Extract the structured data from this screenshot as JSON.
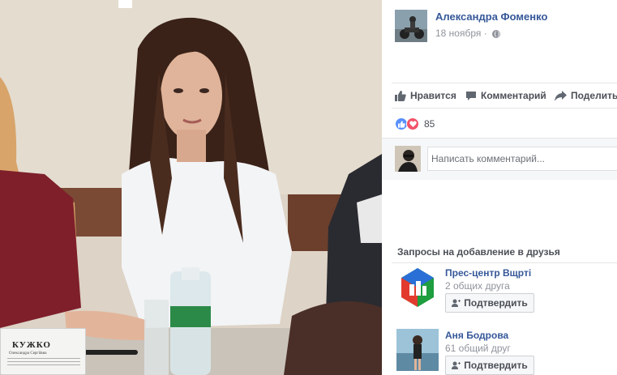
{
  "photo": {
    "placard_name": "КУЖКО",
    "placard_subtitle": "Олександра Сергіївна"
  },
  "post": {
    "author": "Александра Фоменко",
    "date": "18 ноября ·",
    "privacy_icon": "globe-icon",
    "actions": {
      "like": "Нравится",
      "comment": "Комментарий",
      "share": "Поделиться"
    },
    "reaction_icons": [
      "like-icon",
      "heart-icon"
    ],
    "reaction_count": "85",
    "comment_placeholder": "Написать комментарий..."
  },
  "friend_requests": {
    "title": "Запросы на добавление в друзья",
    "items": [
      {
        "name": "Прес-центр Вщрті",
        "mutual": "2 общих друга",
        "button": "Подтвердить"
      },
      {
        "name": "Аня Бодрова",
        "mutual": "61 общий друг",
        "button": "Подтвердить"
      }
    ]
  },
  "colors": {
    "link_blue": "#365899",
    "like_blue": "#5890ff",
    "love_red": "#f25268",
    "muted_text": "#90949c"
  }
}
